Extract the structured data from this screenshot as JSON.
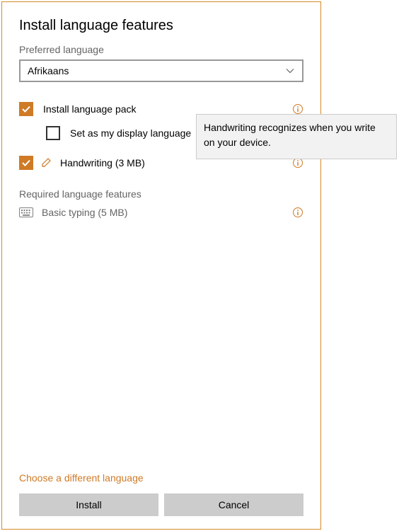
{
  "title": "Install language features",
  "preferredLabel": "Preferred language",
  "selectedLanguage": "Afrikaans",
  "optLanguagePack": "Install language pack",
  "optSetDisplay": "Set as my display language",
  "optHandwriting": "Handwriting (3 MB)",
  "requiredHeader": "Required language features",
  "basicTyping": "Basic typing (5 MB)",
  "chooseDifferent": "Choose a different language",
  "installBtn": "Install",
  "cancelBtn": "Cancel",
  "tooltip": "Handwriting recognizes when you write on your device."
}
